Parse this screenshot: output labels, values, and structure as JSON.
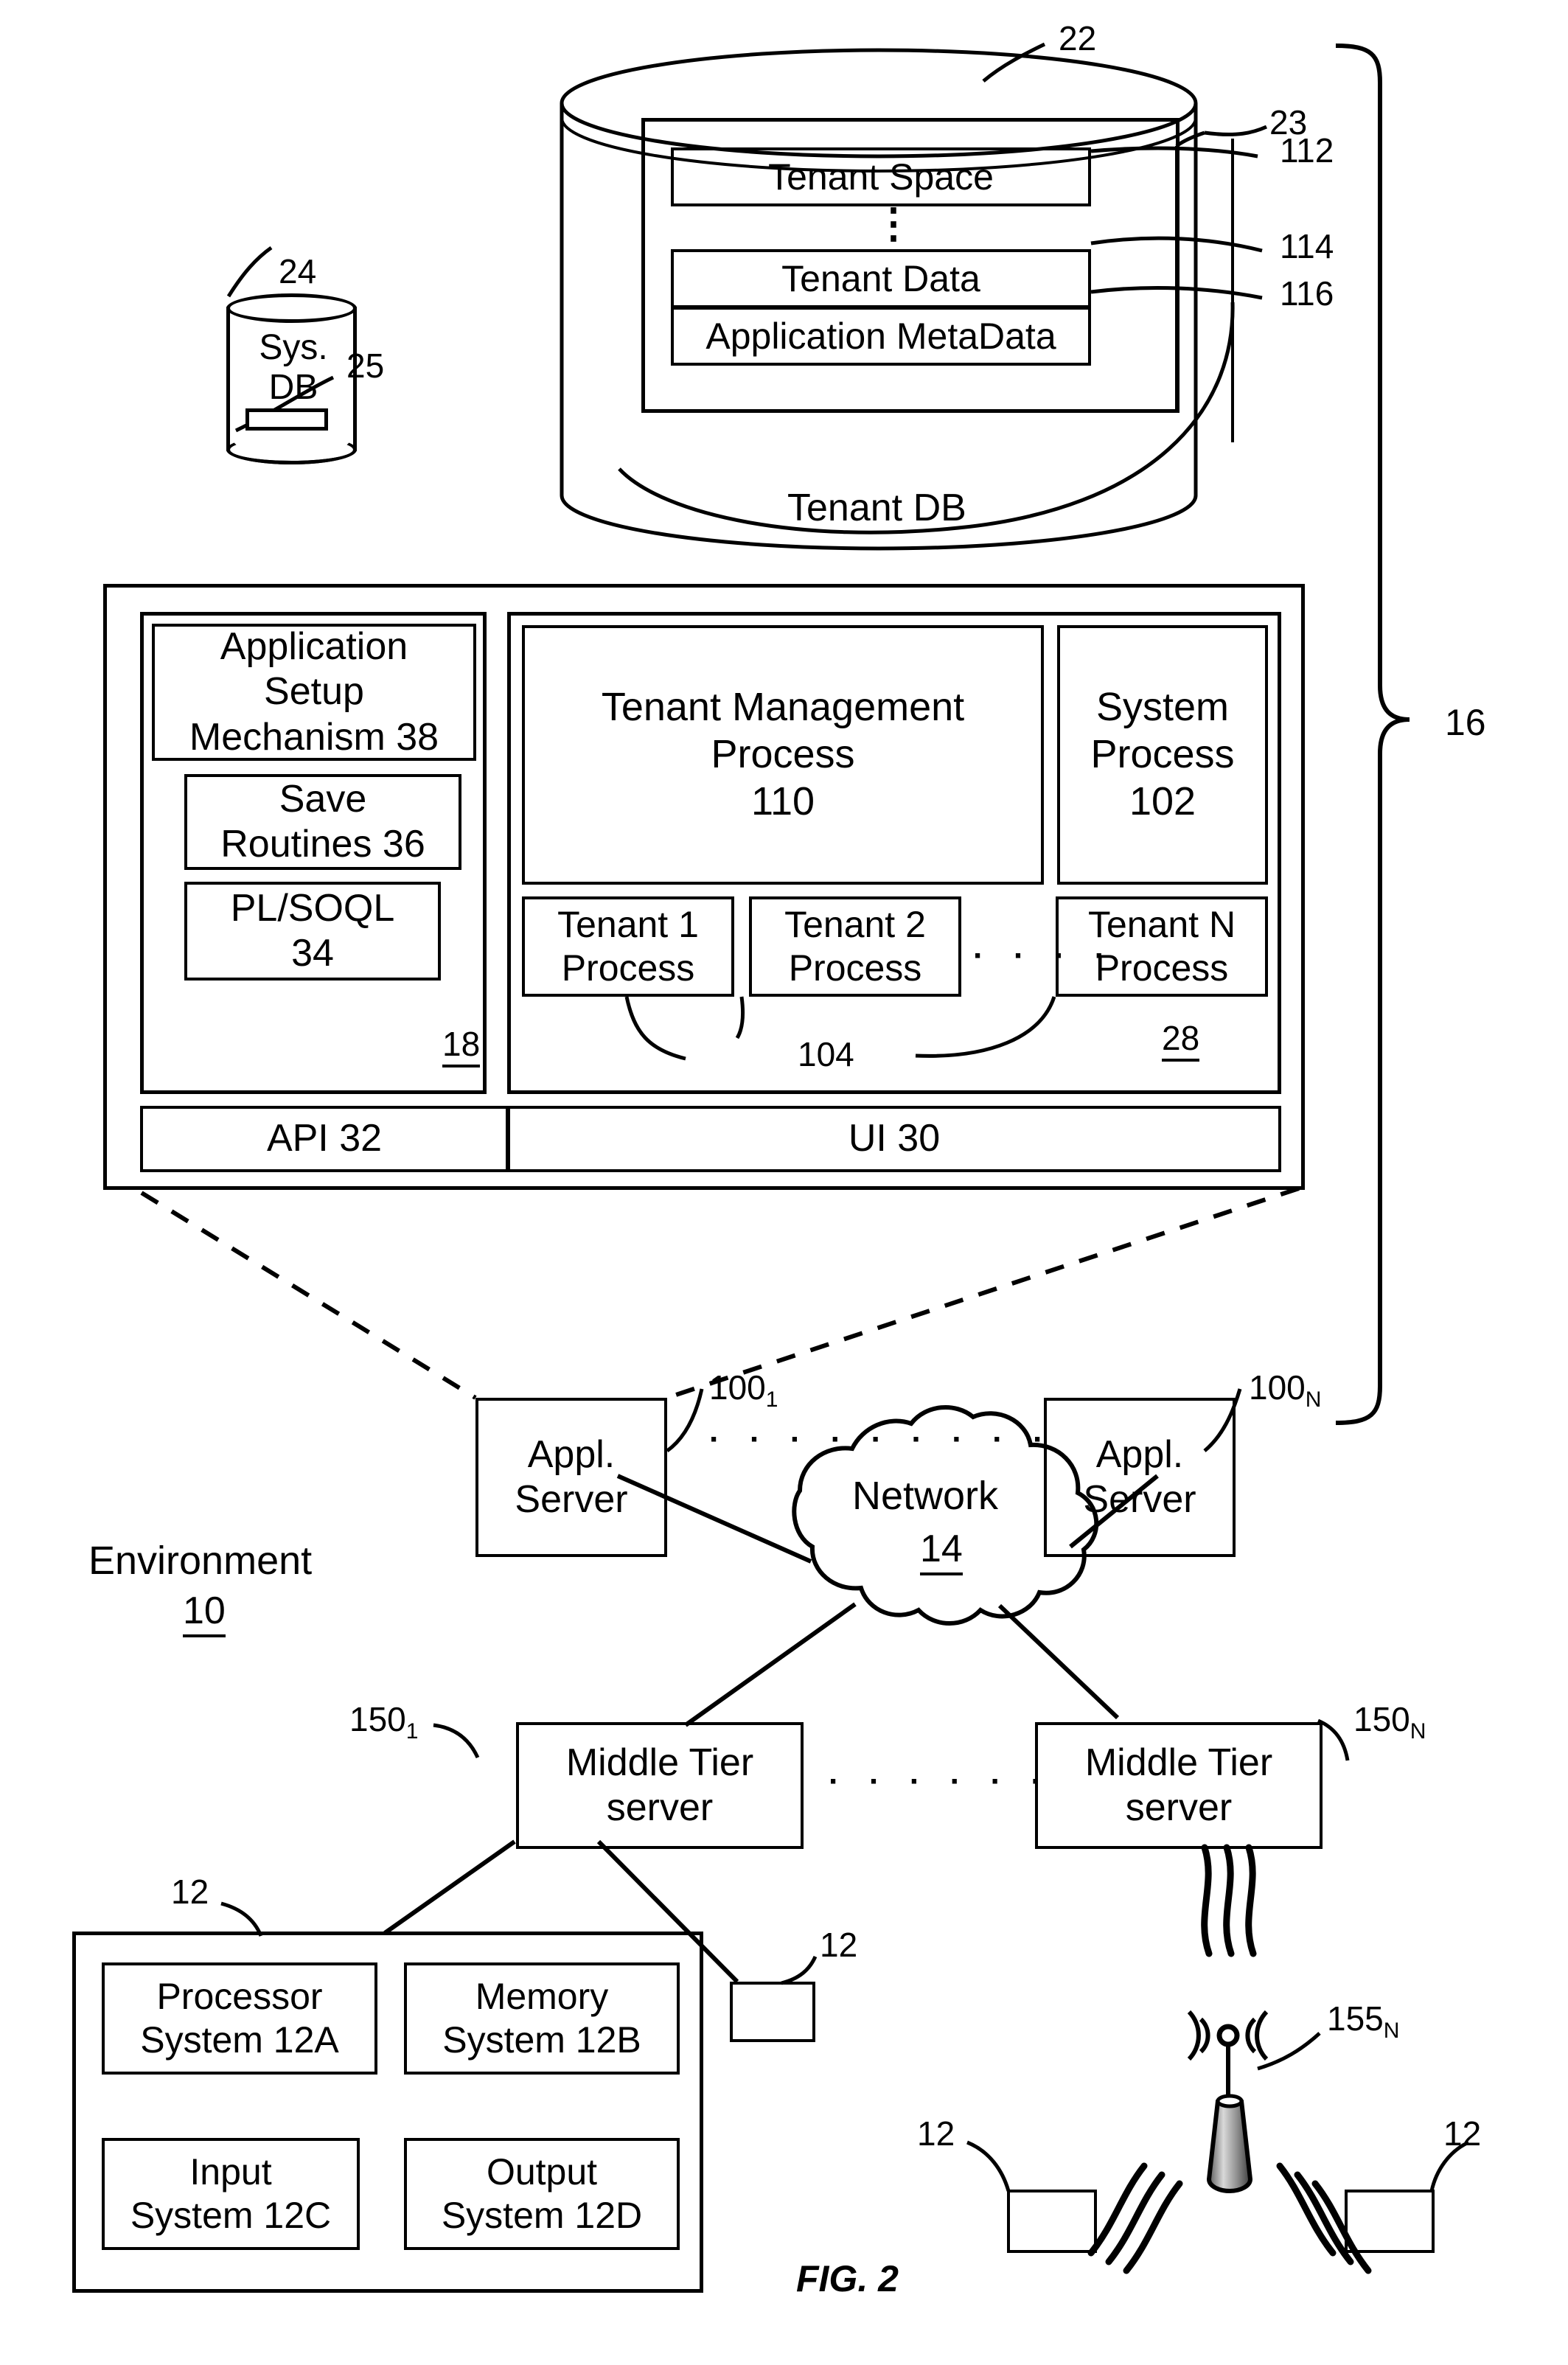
{
  "figure": {
    "caption": "FIG. 2",
    "environment_label": "Environment",
    "environment_ref": "10"
  },
  "tenant_db": {
    "cylinder_ref": "22",
    "inner_container_ref": "23",
    "label": "Tenant DB",
    "rows": [
      {
        "label": "Tenant Space",
        "ref": "112"
      },
      {
        "label": "Tenant Data",
        "ref": "114"
      },
      {
        "label": "Application MetaData",
        "ref": "116"
      }
    ],
    "vertical_ellipsis": "⋮"
  },
  "sys_db": {
    "line1": "Sys.",
    "line2": "DB",
    "ref_cylinder": "24",
    "ref_index": "25"
  },
  "system_bracket": {
    "ref": "16"
  },
  "server_block": {
    "left_panel": {
      "ref": "18",
      "items": [
        {
          "l1": "Application",
          "l2": "Setup",
          "l3": "Mechanism 38"
        },
        {
          "l1": "Save",
          "l2": "Routines 36"
        },
        {
          "l1": "PL/SOQL",
          "l2": "34"
        }
      ]
    },
    "right_panel": {
      "ref": "28",
      "tenant_management": {
        "l1": "Tenant Management",
        "l2": "Process",
        "l3": "110"
      },
      "system_process": {
        "l1": "System",
        "l2": "Process",
        "l3": "102"
      },
      "tenant_processes": [
        {
          "l1": "Tenant 1",
          "l2": "Process"
        },
        {
          "l1": "Tenant 2",
          "l2": "Process"
        },
        {
          "l1": "Tenant N",
          "l2": "Process"
        }
      ],
      "tenant_processes_ref": "104",
      "tenant_dots": "· · · ·"
    },
    "bottom_bar": {
      "api": "API 32",
      "ui": "UI 30"
    }
  },
  "app_servers": [
    {
      "l1": "Appl.",
      "l2": "Server",
      "ref_base": "100",
      "ref_sub": "1"
    },
    {
      "l1": "Appl.",
      "l2": "Server",
      "ref_base": "100",
      "ref_sub": "N"
    }
  ],
  "app_server_dots": "· · · · · · · · ·",
  "network": {
    "label": "Network",
    "ref": "14"
  },
  "middle_tier_servers": [
    {
      "l1": "Middle Tier",
      "l2": "server",
      "ref_base": "150",
      "ref_sub": "1"
    },
    {
      "l1": "Middle Tier",
      "l2": "server",
      "ref_base": "150",
      "ref_sub": "N"
    }
  ],
  "middle_tier_dots": "· · · · · ·",
  "user_system": {
    "ref": "12",
    "cells": [
      {
        "l1": "Processor",
        "l2": "System 12A"
      },
      {
        "l1": "Memory",
        "l2": "System 12B"
      },
      {
        "l1": "Input",
        "l2": "System 12C"
      },
      {
        "l1": "Output",
        "l2": "System 12D"
      }
    ]
  },
  "small_devices": [
    {
      "ref": "12"
    },
    {
      "ref": "12"
    },
    {
      "ref": "12"
    }
  ],
  "antenna": {
    "ref_base": "155",
    "ref_sub": "N"
  }
}
